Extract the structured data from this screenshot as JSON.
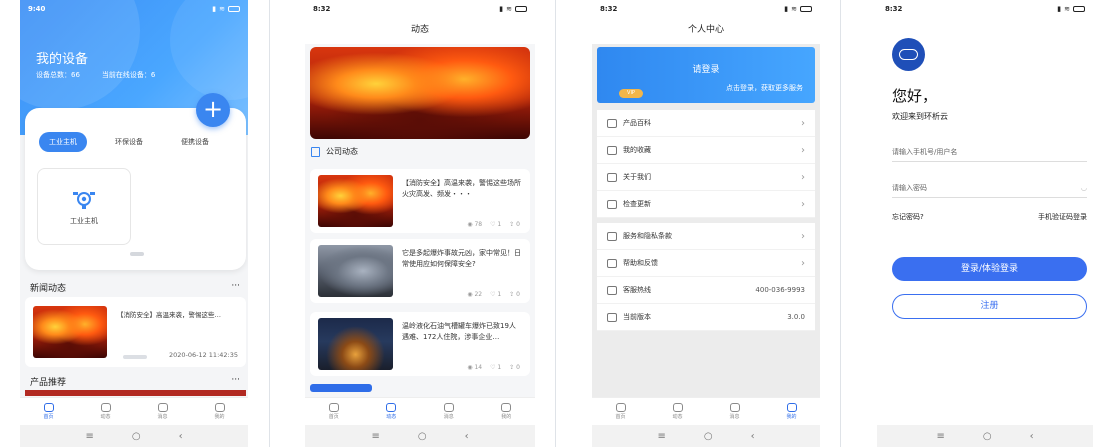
{
  "phone1": {
    "status": {
      "time": "9:40"
    },
    "title": "我的设备",
    "stats": {
      "total": "设备总数：66",
      "online": "当前在线设备：6"
    },
    "chips": [
      "工业主机",
      "环保设备",
      "便携设备"
    ],
    "device_card_label": "工业主机",
    "news_section": "新闻动态",
    "news": {
      "text": "【消防安全】高温来袭，警惕这些…",
      "date": "2020-06-12 11:42:35"
    },
    "products_section": "产品推荐",
    "more": "···"
  },
  "phone2": {
    "status": {
      "time": "8:32"
    },
    "header": "动态",
    "section": "公司动态",
    "items": [
      {
        "text": "【消防安全】高温来袭，警惕这些场所火灾高发、频发・・・",
        "views": "78",
        "likes": "1",
        "shares": "0"
      },
      {
        "text": "它是多起爆炸事故元凶，家中常见！日常使用应如何保障安全?",
        "views": "22",
        "likes": "1",
        "shares": "0"
      },
      {
        "text": "温岭液化石油气槽罐车爆炸已致19人遇难、172人住院，涉事企业…",
        "views": "14",
        "likes": "1",
        "shares": "0"
      }
    ]
  },
  "phone3": {
    "status": {
      "time": "8:32"
    },
    "header": "个人中心",
    "login": {
      "title": "请登录",
      "subtitle": "点击登录，获取更多服务",
      "vip": "VIP"
    },
    "group1": [
      {
        "label": "产品百科",
        "icon": "book-icon"
      },
      {
        "label": "我的收藏",
        "icon": "star-icon"
      },
      {
        "label": "关于我们",
        "icon": "info-icon"
      },
      {
        "label": "检查更新",
        "icon": "refresh-icon"
      }
    ],
    "group2": [
      {
        "label": "服务和隐私条款",
        "icon": "document-icon",
        "value": ""
      },
      {
        "label": "帮助和反馈",
        "icon": "help-icon",
        "value": ""
      },
      {
        "label": "客服热线",
        "icon": "phone-icon",
        "value": "400-036-9993"
      },
      {
        "label": "当前版本",
        "icon": "calendar-icon",
        "value": "3.0.0"
      }
    ]
  },
  "phone4": {
    "status": {
      "time": "8:32"
    },
    "greeting": "您好，",
    "welcome": "欢迎来到环析云",
    "username_placeholder": "请输入手机号/用户名",
    "password_placeholder": "请输入密码",
    "forgot": "忘记密码?",
    "sms_login": "手机验证码登录",
    "login_btn": "登录/体验登录",
    "register_btn": "注册"
  },
  "tabs": [
    "首页",
    "动态",
    "消息",
    "我的"
  ],
  "colors": {
    "primary": "#3a86f0",
    "accent_vip": "#f2b64a"
  }
}
